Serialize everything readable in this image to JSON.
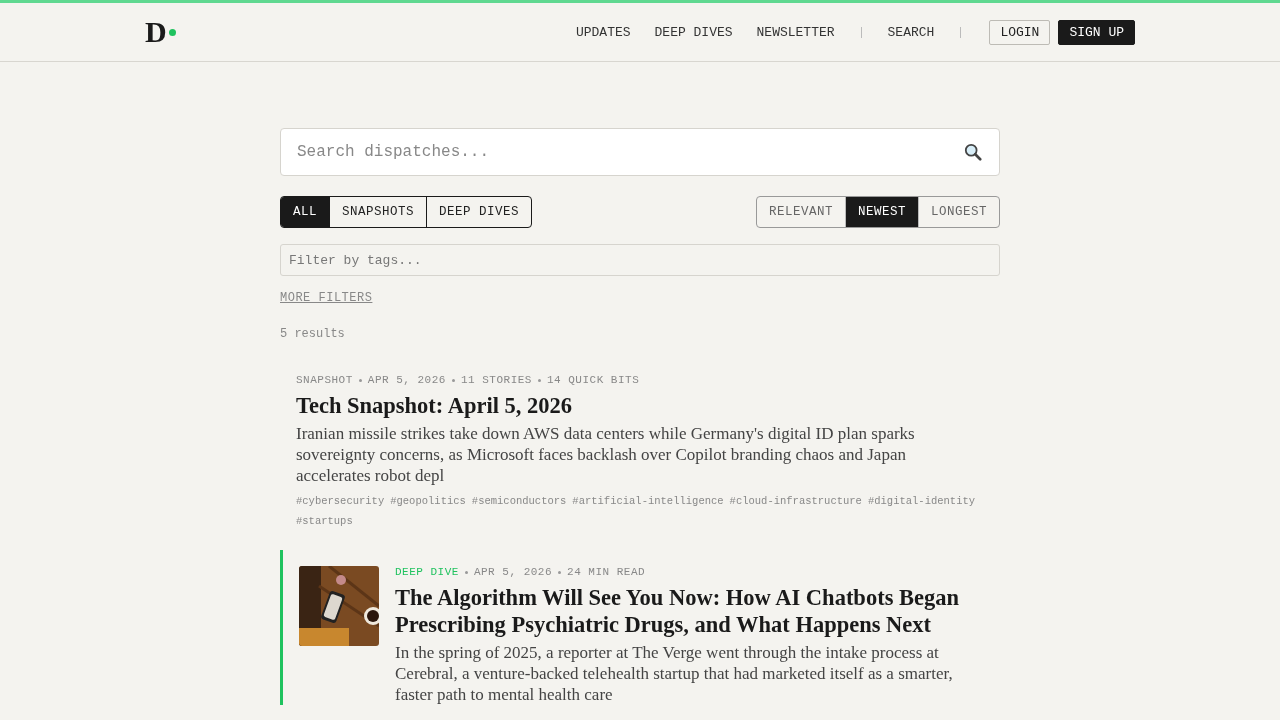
{
  "header": {
    "logo": "D",
    "nav": [
      {
        "label": "UPDATES",
        "kind": "link"
      },
      {
        "label": "DEEP DIVES",
        "kind": "link"
      },
      {
        "label": "NEWSLETTER",
        "kind": "link"
      },
      {
        "kind": "separator"
      },
      {
        "label": "SEARCH",
        "kind": "link"
      },
      {
        "kind": "separator"
      },
      {
        "label": "LOGIN",
        "kind": "outline"
      },
      {
        "label": "SIGN UP",
        "kind": "solid"
      }
    ]
  },
  "search": {
    "placeholder": "Search dispatches..."
  },
  "type_filters": [
    {
      "label": "ALL",
      "selected": true
    },
    {
      "label": "SNAPSHOTS",
      "selected": false
    },
    {
      "label": "DEEP DIVES",
      "selected": false
    }
  ],
  "sort_options": [
    {
      "label": "RELEVANT",
      "selected": false
    },
    {
      "label": "NEWEST",
      "selected": true
    },
    {
      "label": "LONGEST",
      "selected": false
    }
  ],
  "tag_filter": {
    "placeholder": "Filter by tags..."
  },
  "more_filters": "MORE FILTERS",
  "result_count": "5 results",
  "results": [
    {
      "kind": "snapshot",
      "type": "SNAPSHOT",
      "meta": [
        "APR 5, 2026",
        "11 STORIES",
        "14 QUICK BITS"
      ],
      "title": "Tech Snapshot: April 5, 2026",
      "summary": "Iranian missile strikes take down AWS data centers while Germany's digital ID plan sparks sovereignty concerns, as Microsoft faces backlash over Copilot branding chaos and Japan accelerates robot depl",
      "tags": [
        "#cybersecurity",
        "#geopolitics",
        "#semiconductors",
        "#artificial-intelligence",
        "#cloud-infrastructure",
        "#digital-identity",
        "#startups"
      ]
    },
    {
      "kind": "deep_dive",
      "type": "DEEP DIVE",
      "thumbnail": {
        "kind": "picture"
      },
      "meta": [
        "APR 5, 2026",
        "24 MIN READ"
      ],
      "title": "The Algorithm Will See You Now: How AI Chatbots Began Prescribing Psychiatric Drugs, and What Happens Next",
      "summary": "In the spring of 2025, a reporter at The Verge went through the intake process at Cerebral, a venture-backed telehealth startup that had marketed itself as a smarter, faster path to mental health care"
    }
  ]
}
